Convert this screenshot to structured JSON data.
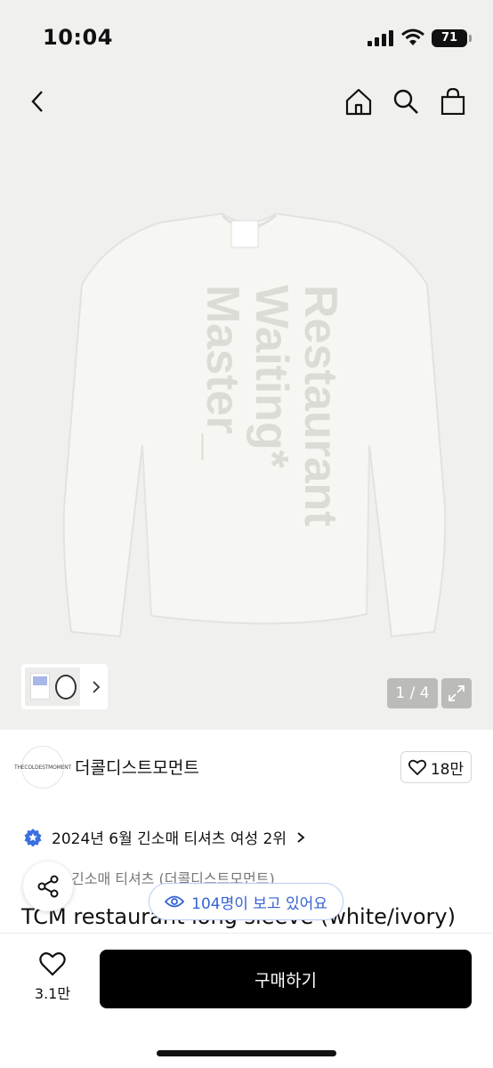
{
  "status_bar": {
    "time": "10:04",
    "battery": "71"
  },
  "nav": {
    "back_icon": "chevron-left-icon",
    "home_icon": "home-icon",
    "search_icon": "search-icon",
    "bag_icon": "shopping-bag-icon"
  },
  "product_image": {
    "print_lines": [
      "Restaurant",
      "Waiting*",
      "Master_"
    ],
    "counter": "1 / 4"
  },
  "shop": {
    "logo_text": "THECOLDESTMOMENT",
    "name": "더콜디스트모먼트",
    "likes": "18만"
  },
  "ranking": {
    "text": "2024년 6월 긴소매 티셔츠 여성 2위",
    "badge_color": "#3a6fe0"
  },
  "category": "긴소매 티셔츠 (더콜디스트모먼트)",
  "title": "TCM restaurant long sleeve (white/ivory)",
  "viewers": "104명이 보고 있어요",
  "bottom_bar": {
    "wish_count": "3.1만",
    "buy_label": "구매하기"
  },
  "colors": {
    "accent": "#3463d3",
    "primary_button": "#000000",
    "image_bg": "#f0f0ee"
  }
}
